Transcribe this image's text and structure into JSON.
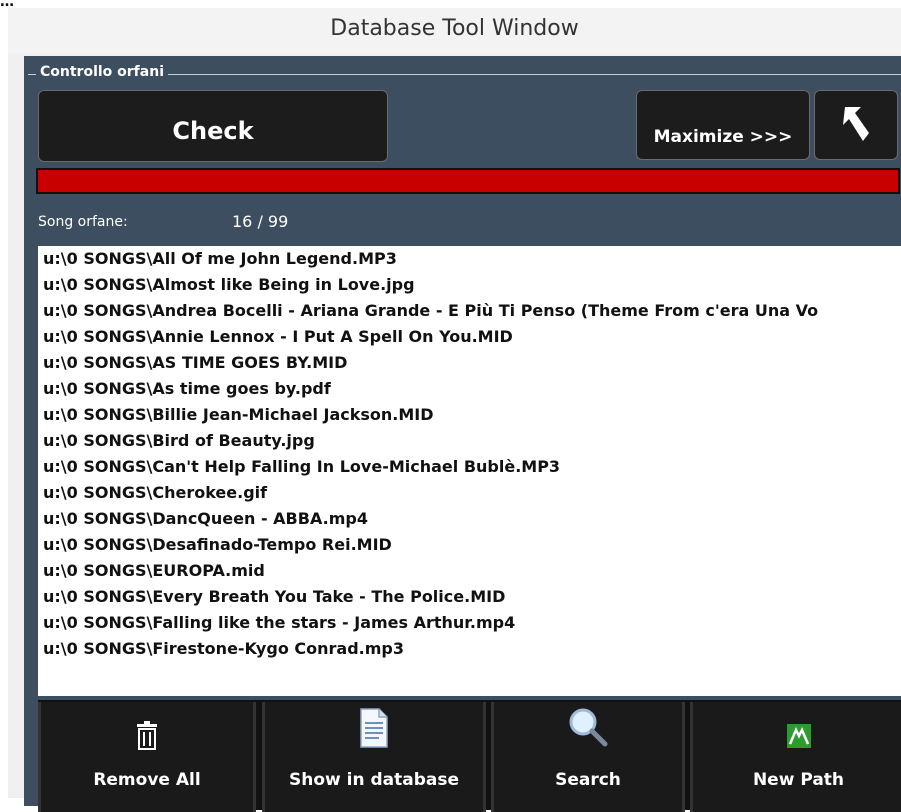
{
  "top_label": "…",
  "window": {
    "title": "Database Tool Window"
  },
  "group": {
    "label": "Controllo orfani"
  },
  "buttons": {
    "check": "Check",
    "maximize": "Maximize >>>"
  },
  "progress": {
    "fill_fraction": 1.0,
    "color": "#c80000"
  },
  "status": {
    "label": "Song orfane:",
    "count": "16 / 99"
  },
  "files": [
    "u:\\0 SONGS\\All Of me John Legend.MP3",
    "u:\\0 SONGS\\Almost like Being in Love.jpg",
    "u:\\0 SONGS\\Andrea Bocelli - Ariana Grande - E Più Ti Penso (Theme From c'era Una Vo",
    "u:\\0 SONGS\\Annie Lennox - I Put A Spell On You.MID",
    "u:\\0 SONGS\\AS TIME GOES BY.MID",
    "u:\\0 SONGS\\As time goes by.pdf",
    "u:\\0 SONGS\\Billie Jean-Michael Jackson.MID",
    "u:\\0 SONGS\\Bird of Beauty.jpg",
    "u:\\0 SONGS\\Can't Help Falling In Love-Michael Bublè.MP3",
    "u:\\0 SONGS\\Cherokee.gif",
    "u:\\0 SONGS\\DancQueen - ABBA.mp4",
    "u:\\0 SONGS\\Desafinado-Tempo Rei.MID",
    "u:\\0 SONGS\\EUROPA.mid",
    "u:\\0 SONGS\\Every Breath You Take - The Police.MID",
    "u:\\0 SONGS\\Falling like the stars - James Arthur.mp4",
    "u:\\0 SONGS\\Firestone-Kygo Conrad.mp3"
  ],
  "toolbar": {
    "remove_all": "Remove All",
    "show_in_database": "Show in database",
    "search": "Search",
    "new_path": "New Path"
  },
  "icons": {
    "back": "return-arrow-icon",
    "remove_all": "trash-icon",
    "show_in_database": "document-icon",
    "search": "magnifier-icon",
    "new_path": "path-icon"
  }
}
